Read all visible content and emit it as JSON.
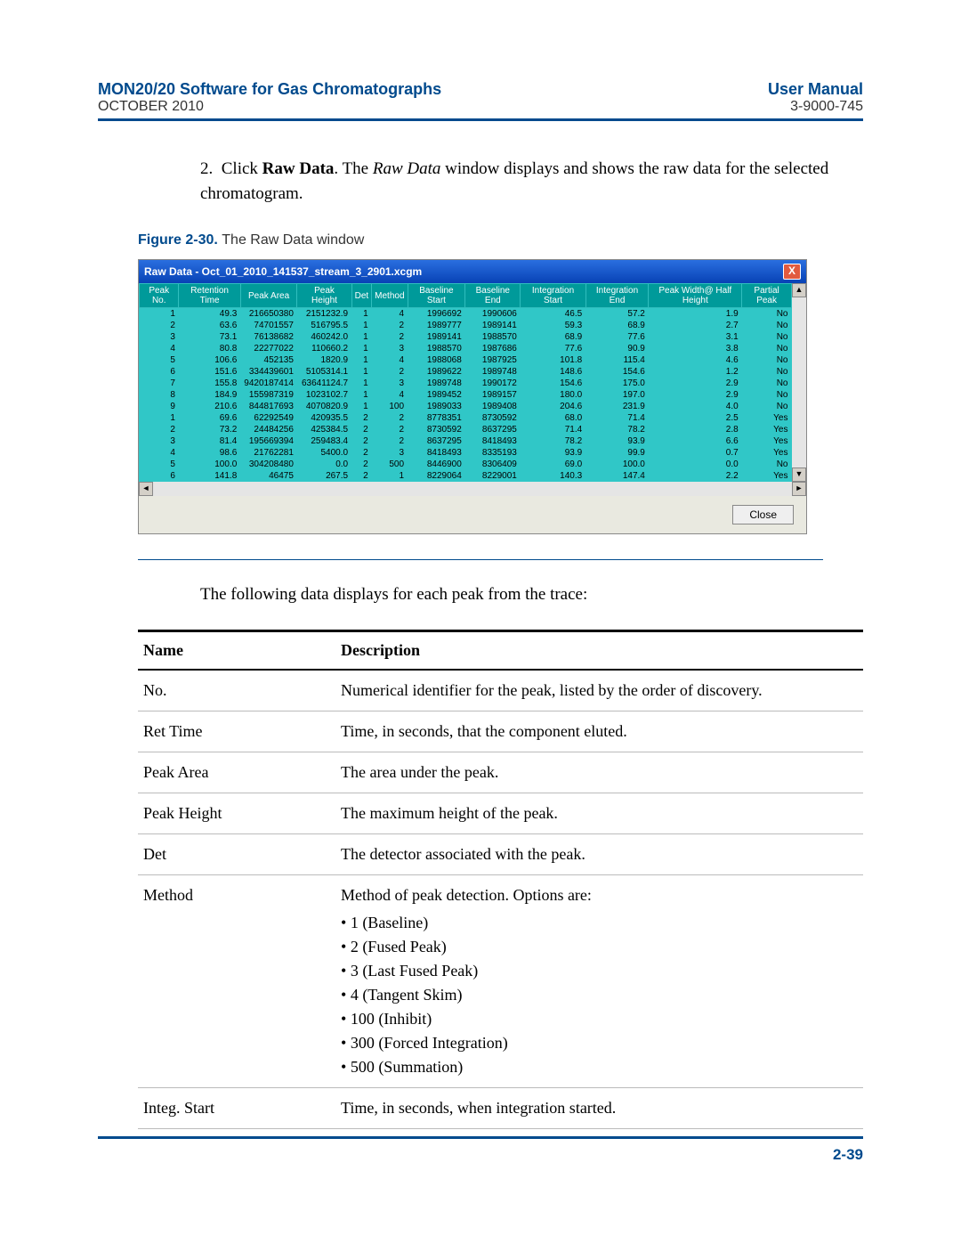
{
  "header": {
    "left_top": "MON20/20 Software for Gas Chromatographs",
    "left_bot": "OCTOBER 2010",
    "right_top": "User Manual",
    "right_bot": "3-9000-745"
  },
  "step_num": "2.",
  "step_pre": "Click ",
  "step_bold": "Raw Data",
  "step_mid": ". The ",
  "step_ital": "Raw Data",
  "step_post": " window displays and shows the raw data for the selected chromatogram.",
  "fig_label": "Figure 2-30.",
  "fig_title": "The Raw Data window",
  "window": {
    "title": "Raw Data - Oct_01_2010_141537_stream_3_2901.xcgm",
    "cols": [
      "Peak No.",
      "Retention Time",
      "Peak Area",
      "Peak Height",
      "Det",
      "Method",
      "Baseline Start",
      "Baseline End",
      "Integration Start",
      "Integration End",
      "Peak Width@ Half Height",
      "Partial Peak"
    ],
    "rows": [
      [
        "1",
        "49.3",
        "216650380",
        "2151232.9",
        "1",
        "4",
        "1996692",
        "1990606",
        "46.5",
        "57.2",
        "1.9",
        "No"
      ],
      [
        "2",
        "63.6",
        "74701557",
        "516795.5",
        "1",
        "2",
        "1989777",
        "1989141",
        "59.3",
        "68.9",
        "2.7",
        "No"
      ],
      [
        "3",
        "73.1",
        "76138682",
        "460242.0",
        "1",
        "2",
        "1989141",
        "1988570",
        "68.9",
        "77.6",
        "3.1",
        "No"
      ],
      [
        "4",
        "80.8",
        "22277022",
        "110660.2",
        "1",
        "3",
        "1988570",
        "1987686",
        "77.6",
        "90.9",
        "3.8",
        "No"
      ],
      [
        "5",
        "106.6",
        "452135",
        "1820.9",
        "1",
        "4",
        "1988068",
        "1987925",
        "101.8",
        "115.4",
        "4.6",
        "No"
      ],
      [
        "6",
        "151.6",
        "334439601",
        "5105314.1",
        "1",
        "2",
        "1989622",
        "1989748",
        "148.6",
        "154.6",
        "1.2",
        "No"
      ],
      [
        "7",
        "155.8",
        "9420187414",
        "63641124.7",
        "1",
        "3",
        "1989748",
        "1990172",
        "154.6",
        "175.0",
        "2.9",
        "No"
      ],
      [
        "8",
        "184.9",
        "155987319",
        "1023102.7",
        "1",
        "4",
        "1989452",
        "1989157",
        "180.0",
        "197.0",
        "2.9",
        "No"
      ],
      [
        "9",
        "210.6",
        "844817693",
        "4070820.9",
        "1",
        "100",
        "1989033",
        "1989408",
        "204.6",
        "231.9",
        "4.0",
        "No"
      ],
      [
        "1",
        "69.6",
        "62292549",
        "420935.5",
        "2",
        "2",
        "8778351",
        "8730592",
        "68.0",
        "71.4",
        "2.5",
        "Yes"
      ],
      [
        "2",
        "73.2",
        "24484256",
        "425384.5",
        "2",
        "2",
        "8730592",
        "8637295",
        "71.4",
        "78.2",
        "2.8",
        "Yes"
      ],
      [
        "3",
        "81.4",
        "195669394",
        "259483.4",
        "2",
        "2",
        "8637295",
        "8418493",
        "78.2",
        "93.9",
        "6.6",
        "Yes"
      ],
      [
        "4",
        "98.6",
        "21762281",
        "5400.0",
        "2",
        "3",
        "8418493",
        "8335193",
        "93.9",
        "99.9",
        "0.7",
        "Yes"
      ],
      [
        "5",
        "100.0",
        "304208480",
        "0.0",
        "2",
        "500",
        "8446900",
        "8306409",
        "69.0",
        "100.0",
        "0.0",
        "No"
      ],
      [
        "6",
        "141.8",
        "46475",
        "267.5",
        "2",
        "1",
        "8229064",
        "8229001",
        "140.3",
        "147.4",
        "2.2",
        "Yes"
      ]
    ],
    "close_btn": "Close"
  },
  "para": "The following data displays for each peak from the trace:",
  "desc": {
    "h1": "Name",
    "h2": "Description",
    "rows": [
      {
        "n": "No.",
        "d": "Numerical identifier for the peak, listed by the order of discovery."
      },
      {
        "n": "Ret Time",
        "d": "Time, in seconds, that the component eluted."
      },
      {
        "n": "Peak Area",
        "d": "The area under the peak."
      },
      {
        "n": "Peak Height",
        "d": "The maximum height of the peak."
      },
      {
        "n": "Det",
        "d": "The detector associated with the peak."
      },
      {
        "n": "Method",
        "d": "Method of peak detection.  Options are:",
        "opts": [
          "1 (Baseline)",
          "2 (Fused Peak)",
          "3 (Last Fused Peak)",
          "4 (Tangent Skim)",
          "100 (Inhibit)",
          "300 (Forced Integration)",
          "500 (Summation)"
        ]
      },
      {
        "n": "Integ. Start",
        "d": "Time, in seconds, when integration started."
      }
    ]
  },
  "footer": "2-39"
}
